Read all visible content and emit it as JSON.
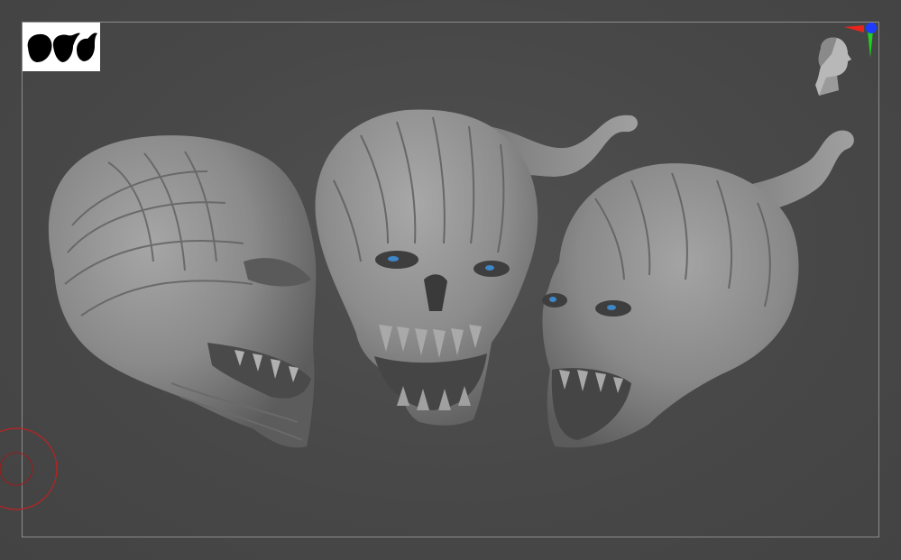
{
  "viewport": {
    "background": "#484848",
    "frame_color": "#8c8c8c"
  },
  "thumbnail": {
    "background": "#ffffff",
    "silhouette_color": "#000000",
    "icon": "three-head-silhouettes-icon"
  },
  "nav_cube": {
    "icon": "head-orientation-icon",
    "axis_colors": {
      "x": "#e8241c",
      "y": "#1fd11f",
      "z": "#1e3cff"
    }
  },
  "models": [
    {
      "view": "side",
      "icon": "demon-skull-side-icon"
    },
    {
      "view": "front",
      "icon": "demon-skull-front-icon",
      "eye_color": "#3d86c8"
    },
    {
      "view": "three-quarter",
      "icon": "demon-skull-three-quarter-icon",
      "eye_color": "#3d86c8"
    }
  ],
  "brush_cursor": {
    "icon": "brush-radius-ring-icon",
    "color": "#c02020"
  },
  "sculpt_color": "#8e8e8e"
}
